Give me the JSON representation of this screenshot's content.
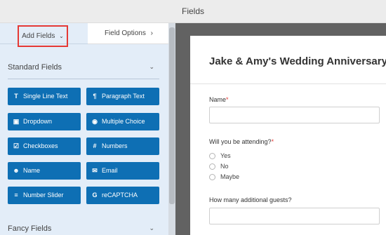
{
  "header": {
    "title": "Fields"
  },
  "tabs": {
    "add_fields": "Add Fields",
    "add_fields_icon": "chevron-down-icon",
    "field_options": "Field Options",
    "field_options_icon": "chevron-right-icon"
  },
  "sections": {
    "standard": {
      "label": "Standard Fields"
    },
    "fancy": {
      "label": "Fancy Fields"
    }
  },
  "standard_fields": [
    {
      "label": "Single Line Text",
      "icon": "text-icon"
    },
    {
      "label": "Paragraph Text",
      "icon": "paragraph-icon"
    },
    {
      "label": "Dropdown",
      "icon": "dropdown-icon"
    },
    {
      "label": "Multiple Choice",
      "icon": "radio-icon"
    },
    {
      "label": "Checkboxes",
      "icon": "checkbox-icon"
    },
    {
      "label": "Numbers",
      "icon": "hash-icon"
    },
    {
      "label": "Name",
      "icon": "user-icon"
    },
    {
      "label": "Email",
      "icon": "envelope-icon"
    },
    {
      "label": "Number Slider",
      "icon": "slider-icon"
    },
    {
      "label": "reCAPTCHA",
      "icon": "google-icon"
    }
  ],
  "form": {
    "title": "Jake & Amy's Wedding Anniversary",
    "name_label": "Name",
    "required_marker": "*",
    "attending_label": "Will you be attending?",
    "attending_options": [
      "Yes",
      "No",
      "Maybe"
    ],
    "guests_label": "How many additional guests?"
  },
  "colors": {
    "accent": "#0e6fb4",
    "highlight_border": "#e53935",
    "panel_bg": "#e3edf8",
    "preview_bg": "#626262"
  }
}
